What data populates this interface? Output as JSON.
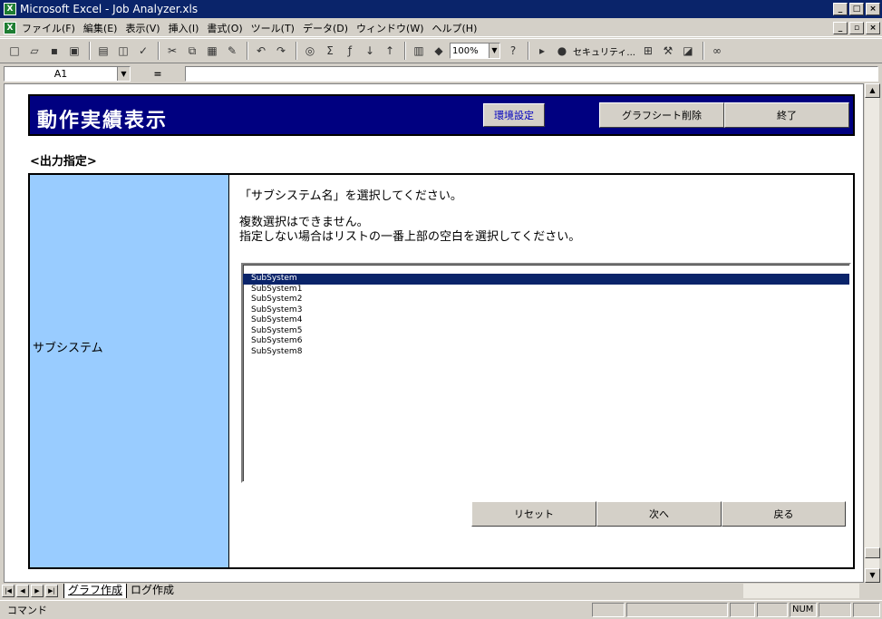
{
  "window": {
    "title": "Microsoft Excel - Job Analyzer.xls",
    "app_icon": "excel-icon"
  },
  "menu": {
    "items": [
      "ファイル(F)",
      "編集(E)",
      "表示(V)",
      "挿入(I)",
      "書式(O)",
      "ツール(T)",
      "データ(D)",
      "ウィンドウ(W)",
      "ヘルプ(H)"
    ]
  },
  "toolbar": {
    "zoom": "100%",
    "security_label": "セキュリティ..."
  },
  "formula": {
    "cell_ref": "A1",
    "eq": "="
  },
  "header": {
    "title": "動作実績表示",
    "settings_label": "環境設定",
    "delete_graph_label": "グラフシート削除",
    "exit_label": "終了"
  },
  "section": {
    "label": "<出力指定>"
  },
  "form": {
    "row_label": "サブシステム",
    "instruction1": "「サブシステム名」を選択してください。",
    "instruction2": "複数選択はできません。",
    "instruction3": "指定しない場合はリストの一番上部の空白を選択してください。",
    "list_items": [
      "SubSystem",
      "SubSystem1",
      "SubSystem2",
      "SubSystem3",
      "SubSystem4",
      "SubSystem5",
      "SubSystem6",
      "SubSystem8"
    ],
    "selected_index": 0,
    "reset_label": "リセット",
    "next_label": "次へ",
    "back_label": "戻る"
  },
  "tabs": {
    "items": [
      "グラフ作成",
      "ログ作成"
    ],
    "active_index": 0
  },
  "status": {
    "text": "コマンド",
    "num": "NUM"
  }
}
